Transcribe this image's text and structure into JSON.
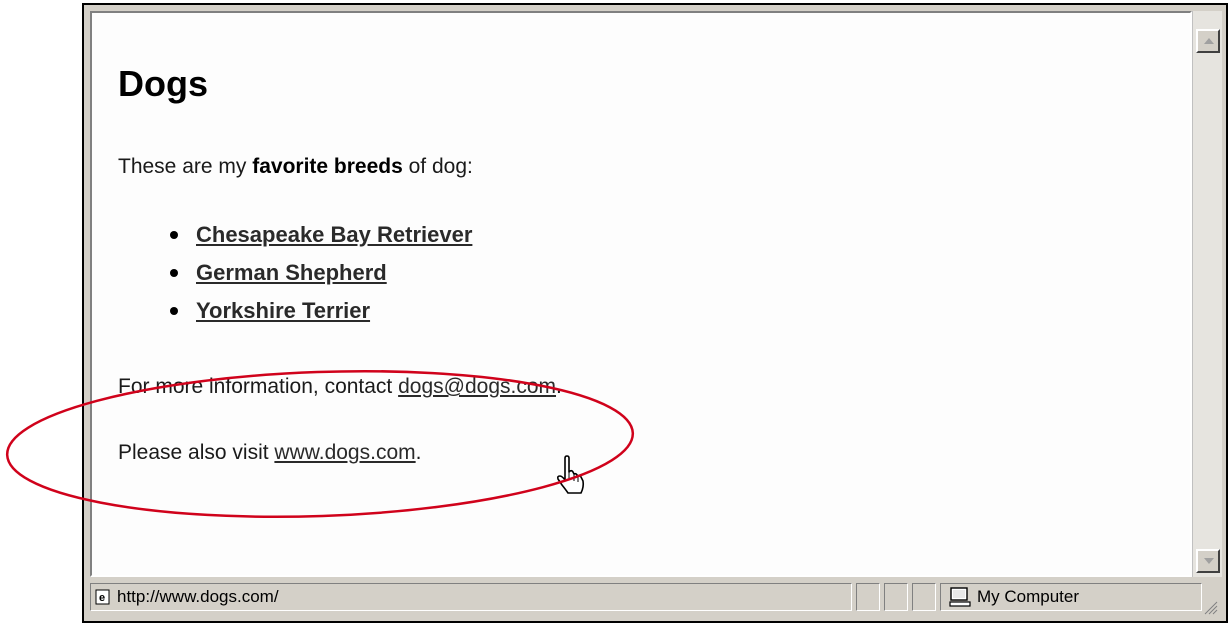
{
  "page": {
    "heading": "Dogs",
    "intro": {
      "before": "These are my ",
      "bold": "favorite breeds",
      "after": " of dog:"
    },
    "breeds": [
      "Chesapeake Bay Retriever",
      "German Shepherd",
      "Yorkshire Terrier"
    ],
    "contact": {
      "before": "For more information, contact ",
      "email": "dogs@dogs.com",
      "after": "."
    },
    "visit": {
      "before": "Please also visit ",
      "link": "www.dogs.com",
      "after": "."
    }
  },
  "status_bar": {
    "url": "http://www.dogs.com/",
    "zone": "My Computer",
    "page_icon": "ie-page-icon",
    "zone_icon": "computer-icon"
  },
  "colors": {
    "annotation": "#d0021b",
    "chrome": "#d4d0c8"
  }
}
